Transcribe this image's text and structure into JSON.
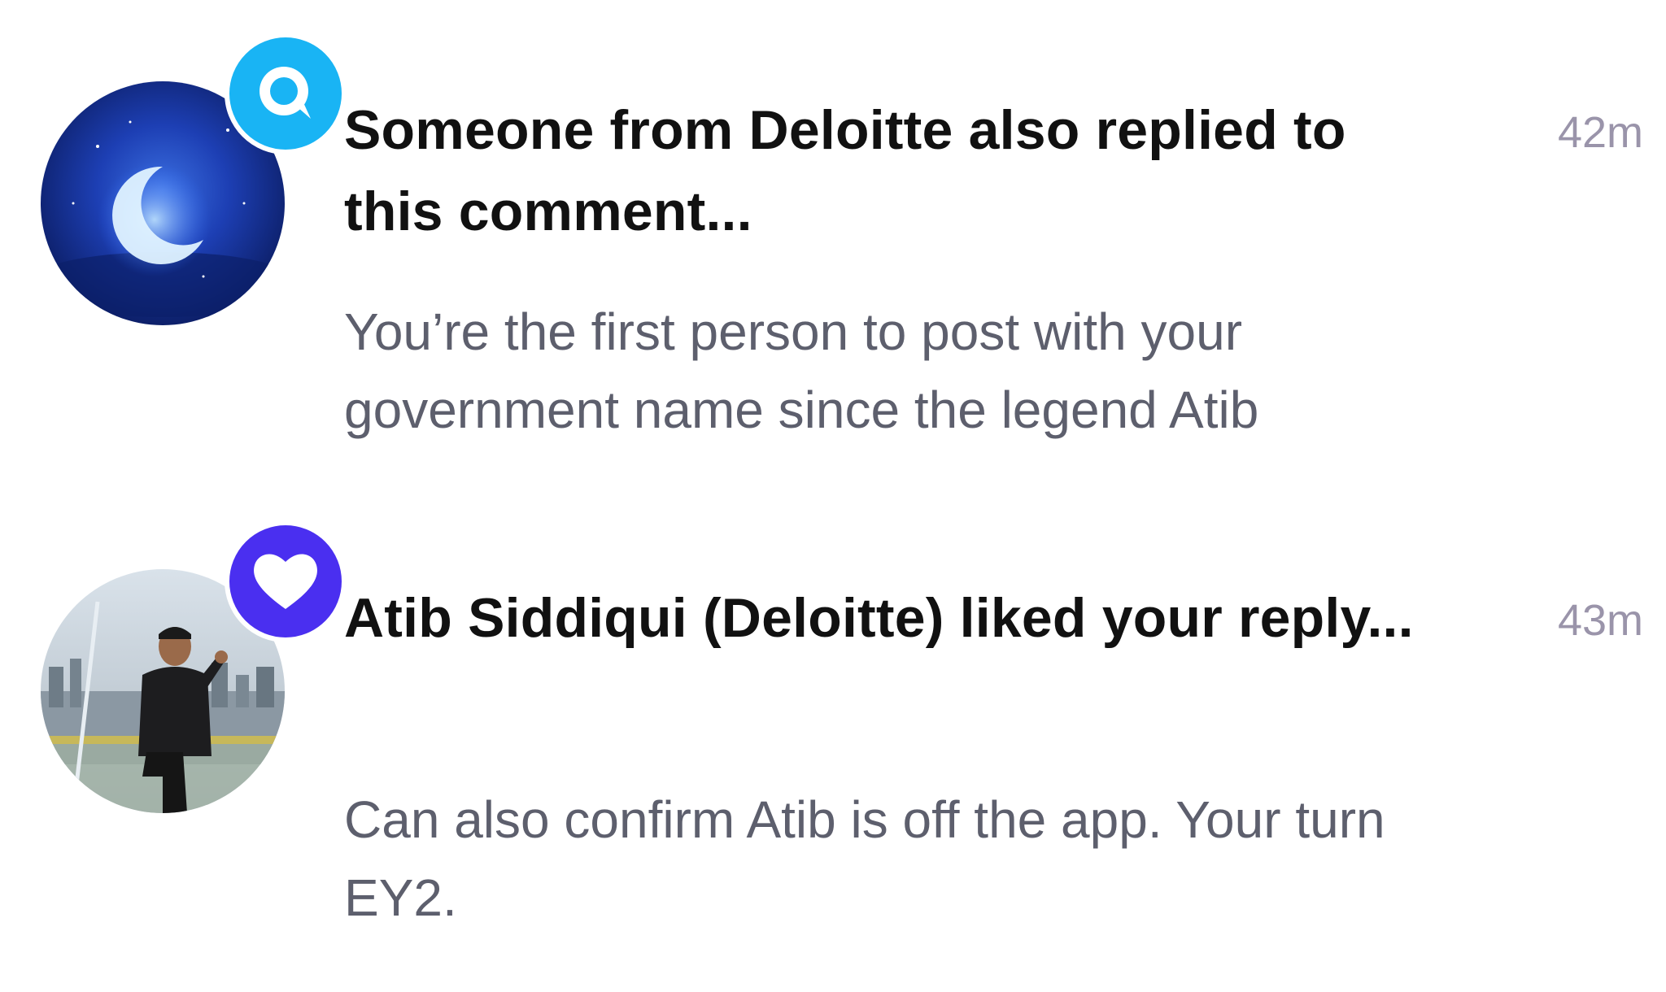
{
  "notifications": [
    {
      "type": "reply",
      "badge_icon": "comment-bubble-icon",
      "badge_color": "#19b4f4",
      "avatar": "moon-night-sky-avatar",
      "title": "Someone from Deloitte also replied to this comment...",
      "body": "You’re the first person to post with your government name since the legend Atib",
      "time": "42m"
    },
    {
      "type": "like",
      "badge_icon": "heart-icon",
      "badge_color": "#4a2ff0",
      "avatar": "user-photo-avatar",
      "title": "Atib Siddiqui (Deloitte) liked your reply...",
      "body": "Can also confirm Atib is off the app. Your turn EY2.",
      "time": "43m"
    }
  ]
}
